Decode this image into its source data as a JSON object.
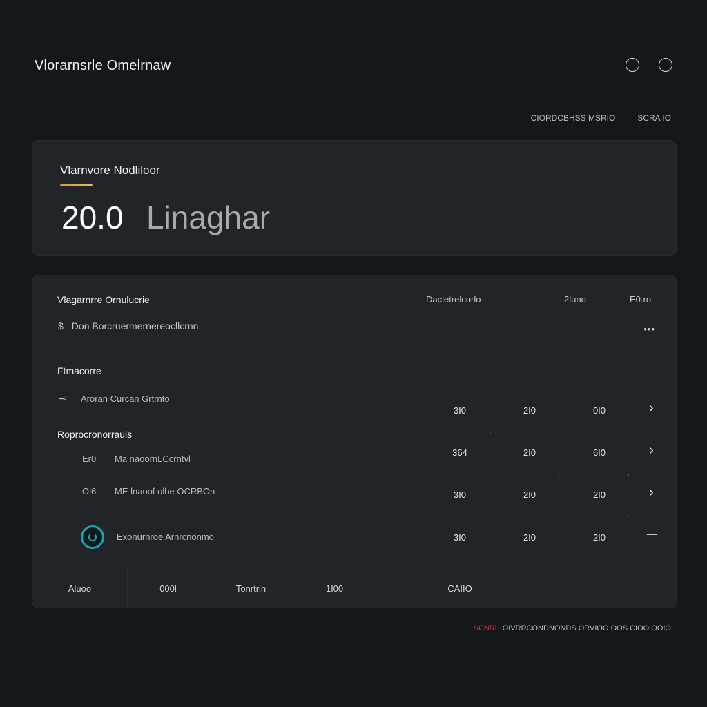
{
  "app": {
    "title": "Vlorarnsrle Omelrnaw"
  },
  "top_meta": {
    "left": "CIORDCBHSS MSRIO",
    "right": "SCRA IO"
  },
  "summary": {
    "label": "Vlarnvore Nodliloor",
    "value": "20.0",
    "unit": "Linaghar",
    "accent_color": "#d79b33"
  },
  "table": {
    "title": "Vlagarnrre Ornulucrie",
    "headers": [
      "Dacletrelcorlo",
      "2luno",
      "E0.ro"
    ],
    "subtitle": "Don Borcruermernereocllcrnn",
    "subtitle_icon": "dollar-icon",
    "more_label": "•••",
    "section1": "Ftmacorre",
    "section2": "Roprocronorrauis",
    "rows": [
      {
        "prefix": "",
        "prefix_icon": "link-icon",
        "label": "Aroran Curcan Grtrnto",
        "values": [
          "3I0",
          "2I0",
          "0I0"
        ],
        "action": "›"
      },
      {
        "prefix": "Er0",
        "label": "Ma naoornLCcrntvl",
        "values": [
          "364",
          "2I0",
          "6I0"
        ],
        "action": "›"
      },
      {
        "prefix": "Ol6",
        "label": "ME lnaoof olbe OCRBOn",
        "values": [
          "3I0",
          "2I0",
          "2I0"
        ],
        "action": "›"
      },
      {
        "prefix": "",
        "prefix_icon": "refresh-ring-icon",
        "label": "Exonurnroe Arnrcnonmo",
        "values": [
          "3I0",
          "2I0",
          "2I0"
        ],
        "action": ""
      }
    ],
    "footer_tabs": [
      "Aluoo",
      "000l",
      "Tonrtrin",
      "1I00",
      "CAIIO"
    ],
    "accent_color": "#1aa4bb"
  },
  "bottom_status": {
    "alert": "SCNRI",
    "text": "OIVRRCONDNONDS ORVIOO OOS CIOO OOIO",
    "alert_color": "#e0353a"
  }
}
